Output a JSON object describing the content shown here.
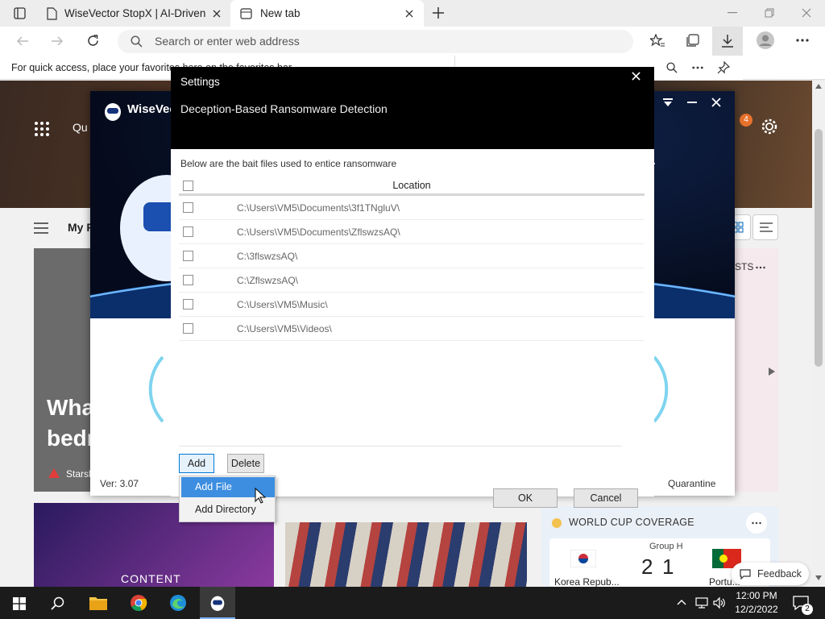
{
  "browser": {
    "tabs": [
      {
        "title": "WiseVector StopX | AI-Driven Me",
        "active": false
      },
      {
        "title": "New tab",
        "active": true
      }
    ],
    "address_placeholder": "Search or enter web address",
    "favorites_bar_text": "For quick access, place your favorites here on the favorites bar."
  },
  "ntp": {
    "headline_partial": "Wha",
    "headline_partial2": "bedr",
    "source_partial": "Starsl",
    "section_partial": "My F",
    "quick_partial": "Qu",
    "trending_partial": "STS",
    "promo_text": "CONTENT",
    "world_cup": {
      "title": "WORLD CUP COVERAGE",
      "group": "Group H",
      "score_home": "2",
      "score_away": "1",
      "team_home": "Korea Repub...",
      "team_away": "Portu..."
    },
    "feedback_label": "Feedback",
    "notification_badge": "4"
  },
  "app": {
    "title": "WiseVector",
    "version": "Ver: 3.07",
    "quarantine_label": "Quarantine"
  },
  "settings": {
    "title": "Settings",
    "subtitle": "Deception-Based Ransomware Detection",
    "description": "Below are the bait files used to entice ransomware",
    "column_location": "Location",
    "files": [
      "C:\\Users\\VM5\\Documents\\3f1TNgluV\\",
      "C:\\Users\\VM5\\Documents\\ZflswzsAQ\\",
      "C:\\3flswzsAQ\\",
      "C:\\ZflswzsAQ\\",
      "C:\\Users\\VM5\\Music\\",
      "C:\\Users\\VM5\\Videos\\"
    ],
    "add_label": "Add",
    "delete_label": "Delete",
    "ok_label": "OK",
    "cancel_label": "Cancel",
    "add_menu": {
      "add_file": "Add File",
      "add_directory": "Add Directory"
    }
  },
  "taskbar": {
    "time": "12:00 PM",
    "date": "12/2/2022",
    "notification_count": "2"
  },
  "colors": {
    "accent_blue": "#3d8ee0",
    "dialog_black": "#000000",
    "app_header_navy": "#050b1c"
  }
}
